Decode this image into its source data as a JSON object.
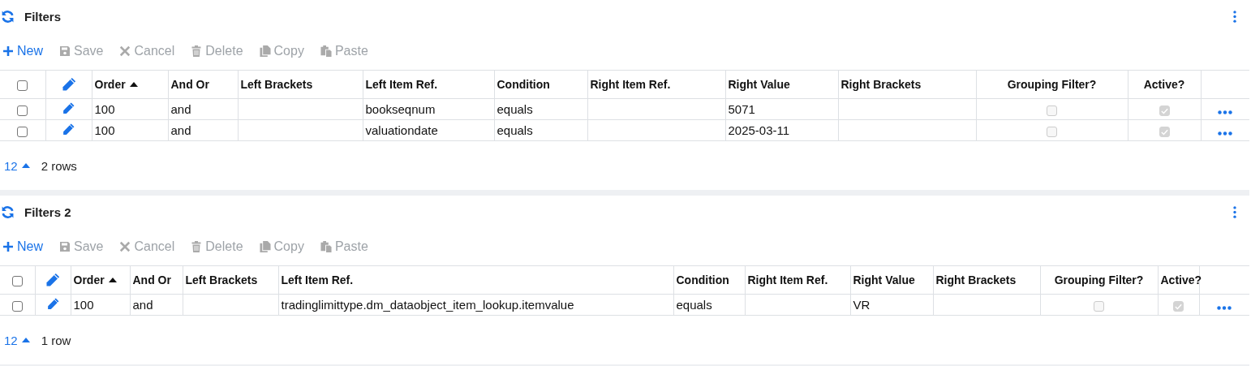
{
  "panels": [
    {
      "title": "Filters",
      "toolbar": [
        {
          "kind": "new",
          "label": "New",
          "disabled": false
        },
        {
          "kind": "save",
          "label": "Save",
          "disabled": true
        },
        {
          "kind": "cancel",
          "label": "Cancel",
          "disabled": true
        },
        {
          "kind": "delete",
          "label": "Delete",
          "disabled": true
        },
        {
          "kind": "copy",
          "label": "Copy",
          "disabled": true
        },
        {
          "kind": "paste",
          "label": "Paste",
          "disabled": true
        }
      ],
      "all_selected": false,
      "columns": [
        {
          "label": "Order",
          "kind": "text",
          "sorted": true
        },
        {
          "label": "And Or",
          "kind": "text",
          "sorted": false
        },
        {
          "label": "Left Brackets",
          "kind": "text",
          "sorted": false
        },
        {
          "label": "Left Item Ref.",
          "kind": "text",
          "sorted": false
        },
        {
          "label": "Condition",
          "kind": "text",
          "sorted": false
        },
        {
          "label": "Right Item Ref.",
          "kind": "text",
          "sorted": false
        },
        {
          "label": "Right Value",
          "kind": "text",
          "sorted": false
        },
        {
          "label": "Right Brackets",
          "kind": "text",
          "sorted": false
        },
        {
          "label": "Grouping Filter?",
          "kind": "check",
          "sorted": false
        },
        {
          "label": "Active?",
          "kind": "check",
          "sorted": false
        }
      ],
      "rows": [
        {
          "selected": false,
          "cells": [
            "100",
            "and",
            null,
            "bookseqnum",
            "equals",
            null,
            "5071",
            null,
            false,
            true
          ]
        },
        {
          "selected": false,
          "cells": [
            "100",
            "and",
            null,
            "valuationdate",
            "equals",
            null,
            "2025-03-11",
            null,
            false,
            true
          ]
        }
      ],
      "page_size": "12",
      "row_count": "2 rows"
    },
    {
      "title": "Filters 2",
      "toolbar": [
        {
          "kind": "new",
          "label": "New",
          "disabled": false
        },
        {
          "kind": "save",
          "label": "Save",
          "disabled": true
        },
        {
          "kind": "cancel",
          "label": "Cancel",
          "disabled": true
        },
        {
          "kind": "delete",
          "label": "Delete",
          "disabled": true
        },
        {
          "kind": "copy",
          "label": "Copy",
          "disabled": true
        },
        {
          "kind": "paste",
          "label": "Paste",
          "disabled": true
        }
      ],
      "all_selected": false,
      "columns": [
        {
          "label": "Order",
          "kind": "text",
          "sorted": true
        },
        {
          "label": "And Or",
          "kind": "text",
          "sorted": false
        },
        {
          "label": "Left Brackets",
          "kind": "text",
          "sorted": false
        },
        {
          "label": "Left Item Ref.",
          "kind": "text",
          "sorted": false
        },
        {
          "label": "Condition",
          "kind": "text",
          "sorted": false
        },
        {
          "label": "Right Item Ref.",
          "kind": "text",
          "sorted": false
        },
        {
          "label": "Right Value",
          "kind": "text",
          "sorted": false
        },
        {
          "label": "Right Brackets",
          "kind": "text",
          "sorted": false
        },
        {
          "label": "Grouping Filter?",
          "kind": "check",
          "sorted": false
        },
        {
          "label": "Active?",
          "kind": "check",
          "sorted": false
        }
      ],
      "rows": [
        {
          "selected": false,
          "cells": [
            "100",
            "and",
            null,
            "tradinglimittype.dm_dataobject_item_lookup.itemvalue",
            "equals",
            null,
            "VR",
            null,
            false,
            true
          ]
        }
      ],
      "page_size": "12",
      "row_count": "1 row"
    }
  ]
}
